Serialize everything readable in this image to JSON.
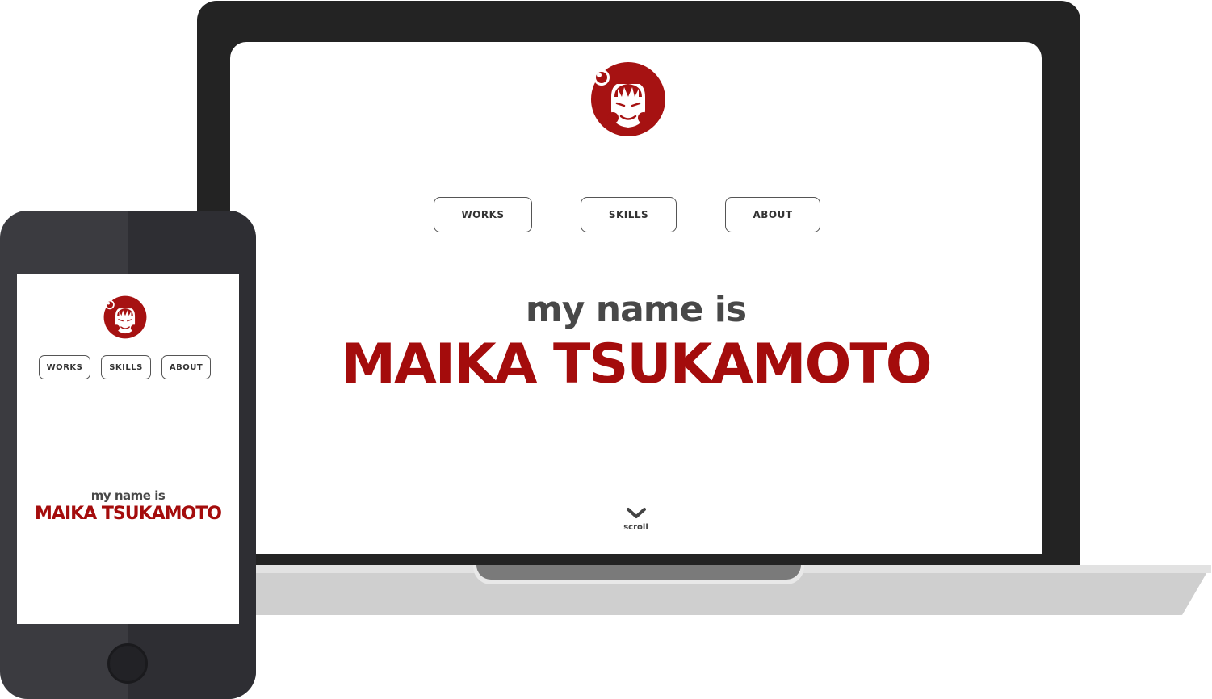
{
  "laptop": {
    "nav": [
      {
        "label": "WORKS"
      },
      {
        "label": "SKILLS"
      },
      {
        "label": "ABOUT"
      }
    ],
    "intro": "my name is",
    "name": "MAIKA TSUKAMOTO",
    "scroll_label": "scroll"
  },
  "phone": {
    "nav": [
      {
        "label": "WORKS"
      },
      {
        "label": "SKILLS"
      },
      {
        "label": "ABOUT"
      }
    ],
    "intro": "my name is",
    "name": "MAIKA TSUKAMOTO"
  },
  "colors": {
    "brand_red": "#a40c0c",
    "laptop_frame": "#232323",
    "phone_body": "#3b3b40"
  },
  "icons": {
    "logo": "girl-face-logo-icon",
    "scroll": "chevron-down-icon"
  }
}
